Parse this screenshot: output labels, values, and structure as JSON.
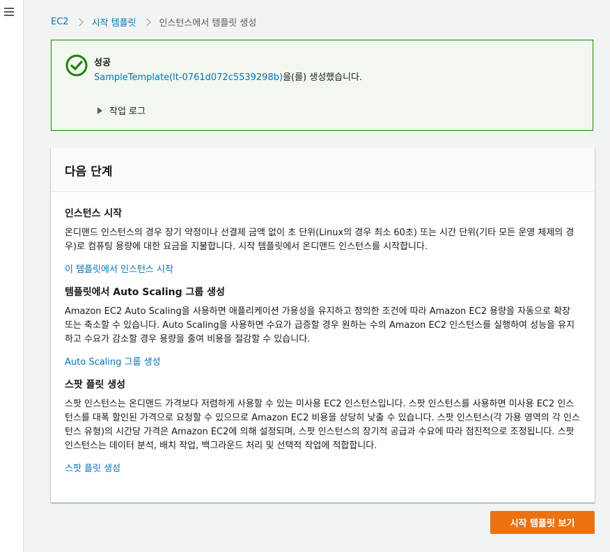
{
  "breadcrumb": {
    "items": [
      "EC2",
      "시작 템플릿"
    ],
    "current": "인스턴스에서 템플릿 생성"
  },
  "flash": {
    "status": "success",
    "title": "성공",
    "template_link": "SampleTemplate(lt-0761d072c5539298b)",
    "message_suffix": "을(를) 생성했습니다.",
    "worklog_label": "작업 로그",
    "border_color": "#1d8102"
  },
  "next_steps": {
    "title": "다음 단계",
    "sections": [
      {
        "title": "인스턴스 시작",
        "description": "온디맨드 인스턴스의 경우 장기 약정이나 선결제 금액 없이 초 단위(Linux의 경우 최소 60초) 또는 시간 단위(기타 모든 운영 체제의 경우)로 컴퓨팅 용량에 대한 요금을 지불합니다. 시작 템플릿에서 온디맨드 인스턴스를 시작합니다.",
        "link": "이 템플릿에서 인스턴스 시작"
      },
      {
        "title": "템플릿에서 Auto Scaling 그룹 생성",
        "description": "Amazon EC2 Auto Scaling을 사용하면 애플리케이션 가용성을 유지하고 정의한 조건에 따라 Amazon EC2 용량을 자동으로 확장 또는 축소할 수 있습니다. Auto Scaling을 사용하면 수요가 급증할 경우 원하는 수의 Amazon EC2 인스턴스를 실행하여 성능을 유지하고 수요가 감소할 경우 용량을 줄여 비용을 절감할 수 있습니다.",
        "link": "Auto Scaling 그룹 생성"
      },
      {
        "title": "스팟 플릿 생성",
        "description": "스팟 인스턴스는 온디맨드 가격보다 저렴하게 사용할 수 있는 미사용 EC2 인스턴스입니다. 스팟 인스턴스를 사용하면 미사용 EC2 인스턴스를 대폭 할인된 가격으로 요청할 수 있으므로 Amazon EC2 비용을 상당히 낮출 수 있습니다. 스팟 인스턴스(각 가용 영역의 각 인스턴스 유형)의 시간당 가격은 Amazon EC2에 의해 설정되며, 스팟 인스턴스의 장기적 공급과 수요에 따라 점진적으로 조정됩니다. 스팟 인스턴스는 데이터 분석, 배치 작업, 백그라운드 처리 및 선택적 작업에 적합합니다.",
        "link": "스팟 플릿 생성"
      }
    ]
  },
  "actions": {
    "view_templates": "시작 템플릿 보기",
    "accent_color": "#ec7211"
  }
}
